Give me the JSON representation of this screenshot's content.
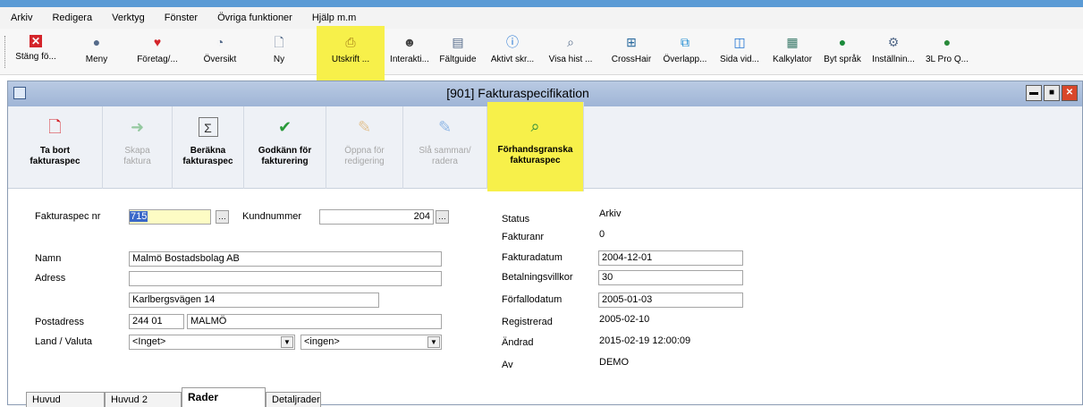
{
  "menu": [
    "Arkiv",
    "Redigera",
    "Verktyg",
    "Fönster",
    "Övriga funktioner",
    "Hjälp m.m"
  ],
  "toolbar": {
    "items": [
      {
        "label": "Stäng fö...",
        "icon": "close-icon",
        "color": "#d4242a"
      },
      {
        "label": "Meny",
        "icon": "menu-icon",
        "color": "#556b8a"
      },
      {
        "label": "Företag/...",
        "icon": "heart-icon",
        "color": "#d4242a"
      },
      {
        "label": "Översikt",
        "icon": "overview-icon",
        "color": "#556b8a"
      },
      {
        "label": "Ny",
        "icon": "new-document-icon",
        "color": "#556b8a"
      },
      {
        "label": "Utskrift ...",
        "icon": "printer-icon",
        "color": "#c9a23a"
      },
      {
        "label": "Interakti...",
        "icon": "people-icon",
        "color": "#444"
      },
      {
        "label": "Fältguide",
        "icon": "field-guide-icon",
        "color": "#556b8a"
      },
      {
        "label": "Aktivt skr...",
        "icon": "info-icon",
        "color": "#1a6fd1"
      },
      {
        "label": "Visa hist ...",
        "icon": "history-icon",
        "color": "#556b8a"
      },
      {
        "label": "CrossHair",
        "icon": "crosshair-icon",
        "color": "#2a6a9e"
      },
      {
        "label": "Överlapp...",
        "icon": "overlap-icon",
        "color": "#1a8ad1"
      },
      {
        "label": "Sida vid...",
        "icon": "side-by-side-icon",
        "color": "#1a6fd1"
      },
      {
        "label": "Kalkylator",
        "icon": "calculator-icon",
        "color": "#3a7a6a"
      },
      {
        "label": "Byt språk",
        "icon": "globe-icon",
        "color": "#1a8a3a"
      },
      {
        "label": "Inställnin...",
        "icon": "settings-icon",
        "color": "#556b8a"
      },
      {
        "label": "3L Pro Q...",
        "icon": "pro-icon",
        "color": "#2a8a3a"
      }
    ]
  },
  "window": {
    "title": "[901]  Fakturaspecifikation"
  },
  "ribbon": [
    {
      "label": "Ta bort\nfakturaspec",
      "icon": "delete-icon",
      "enabled": true
    },
    {
      "label": "Skapa\nfaktura",
      "icon": "create-invoice-icon",
      "enabled": false
    },
    {
      "label": "Beräkna\nfakturaspec",
      "icon": "sum-icon",
      "enabled": true
    },
    {
      "label": "Godkänn för\nfakturering",
      "icon": "approve-icon",
      "enabled": true
    },
    {
      "label": "Öppna för\nredigering",
      "icon": "edit-open-icon",
      "enabled": false
    },
    {
      "label": "Slå samman/\nradera",
      "icon": "merge-icon",
      "enabled": false
    },
    {
      "label": "Förhandsgranska\nfakturaspec",
      "icon": "preview-icon",
      "enabled": true
    }
  ],
  "form": {
    "fakturaspec_nr_label": "Fakturaspec nr",
    "fakturaspec_nr": "715",
    "kundnummer_label": "Kundnummer",
    "kundnummer": "204",
    "namn_label": "Namn",
    "namn": "Malmö Bostadsbolag AB",
    "adress_label": "Adress",
    "adress1": "",
    "adress2": "Karlbergsvägen 14",
    "postadress_label": "Postadress",
    "postnummer": "244 01",
    "ort": "MALMÖ",
    "land_valuta_label": "Land / Valuta",
    "land": "<Inget>",
    "valuta": "<ingen>"
  },
  "status": {
    "status_label": "Status",
    "status": "Arkiv",
    "fakturanr_label": "Fakturanr",
    "fakturanr": "0",
    "fakturadatum_label": "Fakturadatum",
    "fakturadatum": "2004-12-01",
    "betalningsvillkor_label": "Betalningsvillkor",
    "betalningsvillkor": "30",
    "forfallodatum_label": "Förfallodatum",
    "forfallodatum": "2005-01-03",
    "registrerad_label": "Registrerad",
    "registrerad": "2005-02-10",
    "andrad_label": "Ändrad",
    "andrad": "2015-02-19 12:00:09",
    "av_label": "Av",
    "av": "DEMO"
  },
  "tabs": [
    "Huvud",
    "Huvud 2",
    "Rader",
    "Detaljrader"
  ],
  "active_tab": "Rader",
  "highlight_color": "#f7f04a"
}
